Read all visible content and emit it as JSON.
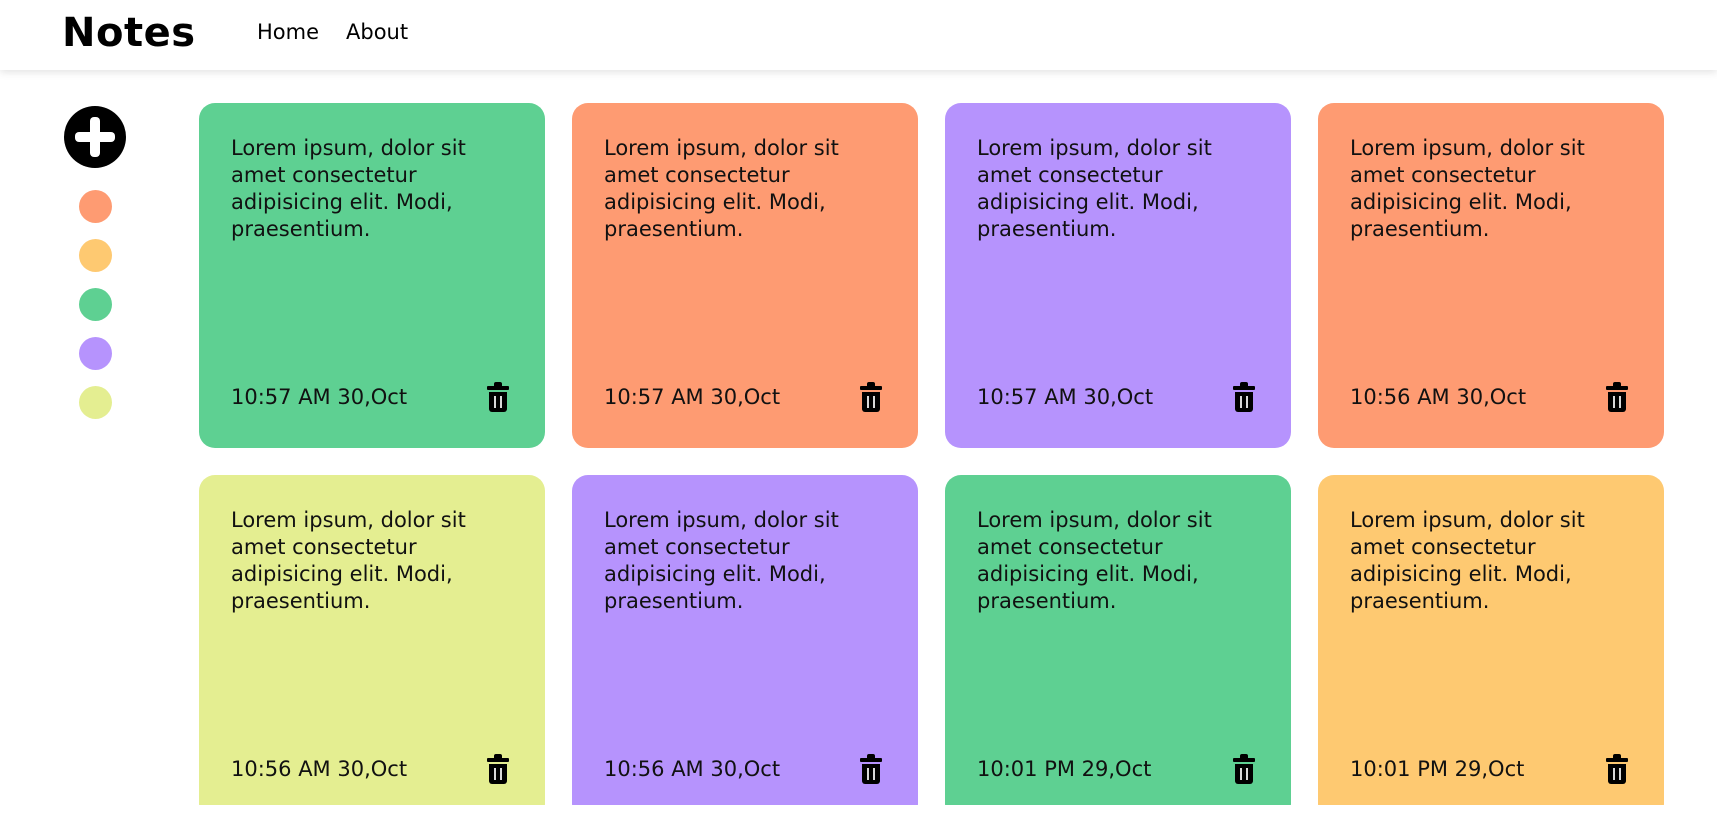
{
  "app": {
    "brand": "Notes",
    "nav": [
      "Home",
      "About"
    ]
  },
  "sidebar": {
    "add_icon": "plus-circle-icon",
    "swatches": [
      {
        "name": "orange",
        "color": "#fe9b72"
      },
      {
        "name": "yellow",
        "color": "#fec971"
      },
      {
        "name": "green",
        "color": "#5ed092"
      },
      {
        "name": "purple",
        "color": "#b693fd"
      },
      {
        "name": "lime",
        "color": "#e4ee91"
      }
    ]
  },
  "notes": [
    {
      "text": "Lorem ipsum, dolor sit amet consectetur adipisicing elit. Modi, praesentium.",
      "time": "10:57 AM 30,Oct",
      "color": "#5ed092"
    },
    {
      "text": "Lorem ipsum, dolor sit amet consectetur adipisicing elit. Modi, praesentium.",
      "time": "10:57 AM 30,Oct",
      "color": "#fe9b72"
    },
    {
      "text": "Lorem ipsum, dolor sit amet consectetur adipisicing elit. Modi, praesentium.",
      "time": "10:57 AM 30,Oct",
      "color": "#b693fd"
    },
    {
      "text": "Lorem ipsum, dolor sit amet consectetur adipisicing elit. Modi, praesentium.",
      "time": "10:56 AM 30,Oct",
      "color": "#fe9b72"
    },
    {
      "text": "Lorem ipsum, dolor sit amet consectetur adipisicing elit. Modi, praesentium.",
      "time": "10:56 AM 30,Oct",
      "color": "#e4ee91"
    },
    {
      "text": "Lorem ipsum, dolor sit amet consectetur adipisicing elit. Modi, praesentium.",
      "time": "10:56 AM 30,Oct",
      "color": "#b693fd"
    },
    {
      "text": "Lorem ipsum, dolor sit amet consectetur adipisicing elit. Modi, praesentium.",
      "time": "10:01 PM 29,Oct",
      "color": "#5ed092"
    },
    {
      "text": "Lorem ipsum, dolor sit amet consectetur adipisicing elit. Modi, praesentium.",
      "time": "10:01 PM 29,Oct",
      "color": "#fec971"
    }
  ],
  "icons": {
    "delete": "trash-icon"
  }
}
